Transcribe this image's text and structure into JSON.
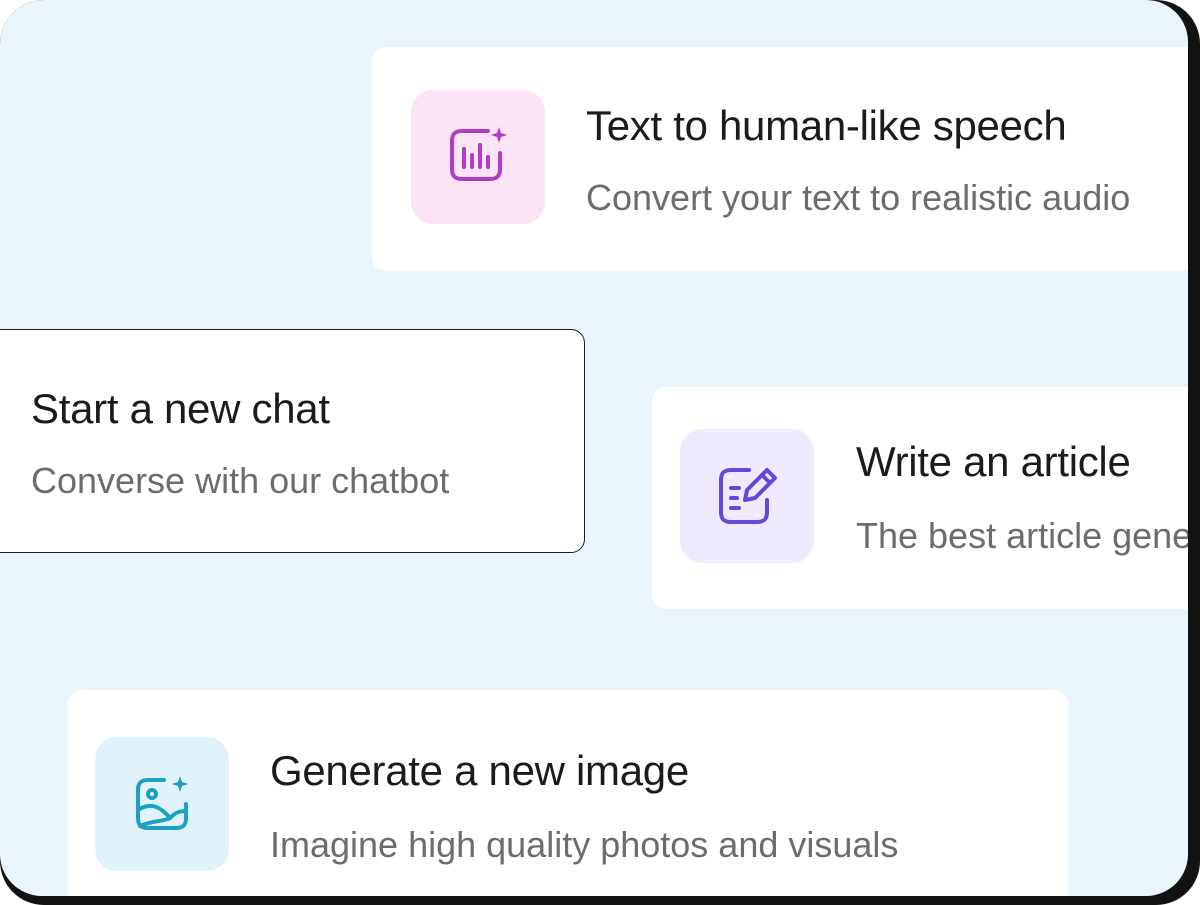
{
  "cards": {
    "speech": {
      "title": "Text to human-like speech",
      "description": "Convert your text to realistic audio",
      "icon": "audio-wave-sparkle-icon",
      "icon_color": "#b23bc8",
      "tile_color": "#fbe4f6"
    },
    "chat": {
      "title": "Start a new chat",
      "description": "Converse with our chatbot"
    },
    "article": {
      "title": "Write an article",
      "description": "The best article generator",
      "icon": "edit-document-icon",
      "icon_color": "#6b45d9",
      "tile_color": "#efeafd"
    },
    "image": {
      "title": "Generate a new image",
      "description": "Imagine high quality photos and visuals",
      "icon": "image-sparkle-icon",
      "icon_color": "#1e9fc4",
      "tile_color": "#e1f3fa"
    }
  }
}
